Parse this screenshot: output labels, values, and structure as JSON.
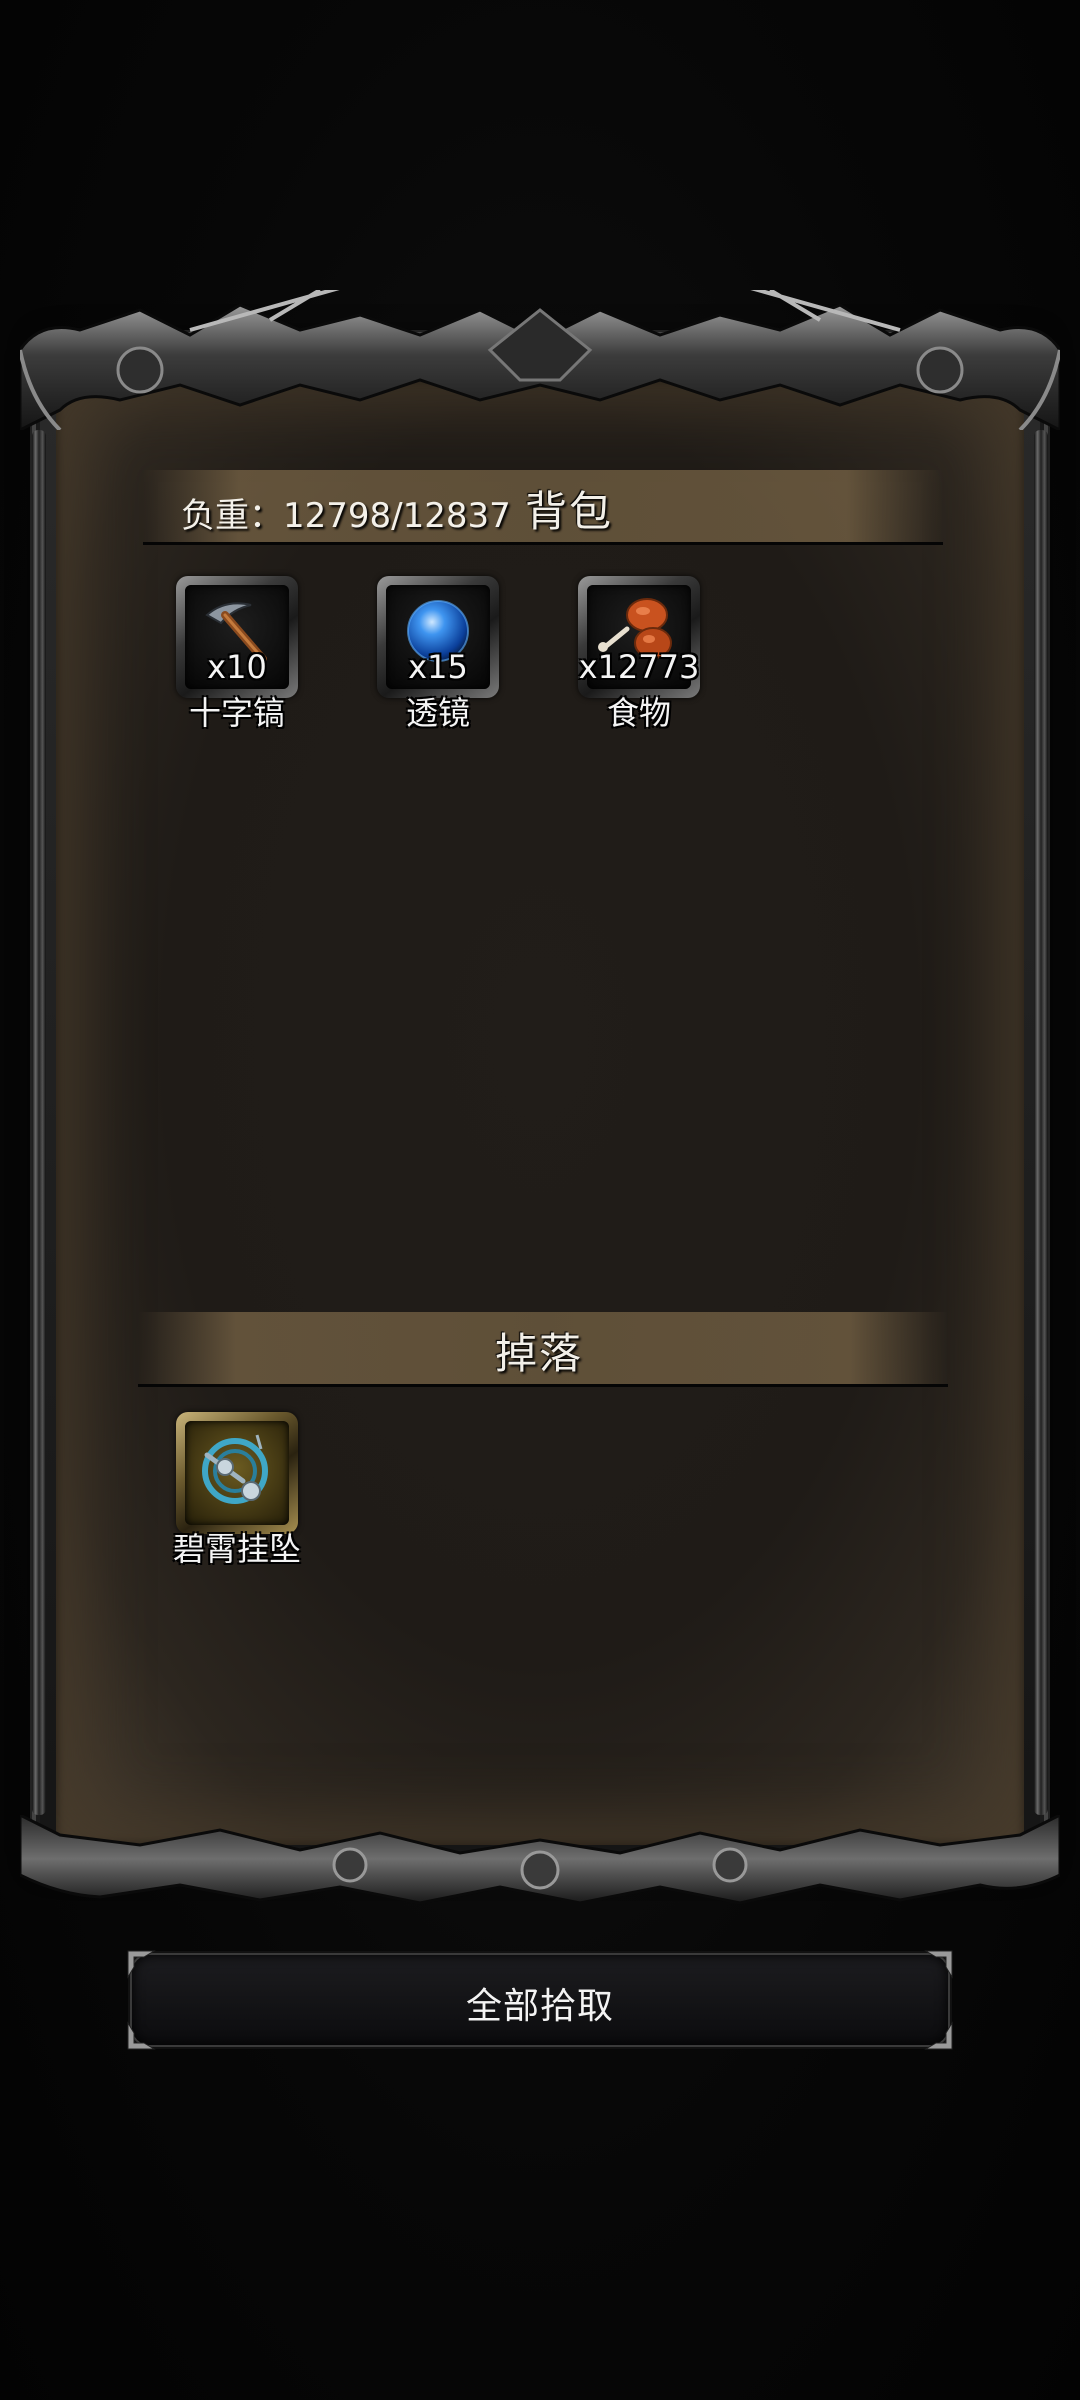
{
  "inventory": {
    "weight_label": "负重：12798/12837",
    "title": "背包",
    "items": [
      {
        "icon": "pickaxe-icon",
        "count": "x10",
        "name": "十字镐"
      },
      {
        "icon": "lens-orb-icon",
        "count": "x15",
        "name": "透镜"
      },
      {
        "icon": "food-drumstick-icon",
        "count": "x12773",
        "name": "食物"
      }
    ]
  },
  "drops": {
    "title": "掉落",
    "items": [
      {
        "icon": "jade-pendant-icon",
        "name": "碧霄挂坠"
      }
    ]
  },
  "actions": {
    "pickup_all_label": "全部拾取"
  }
}
